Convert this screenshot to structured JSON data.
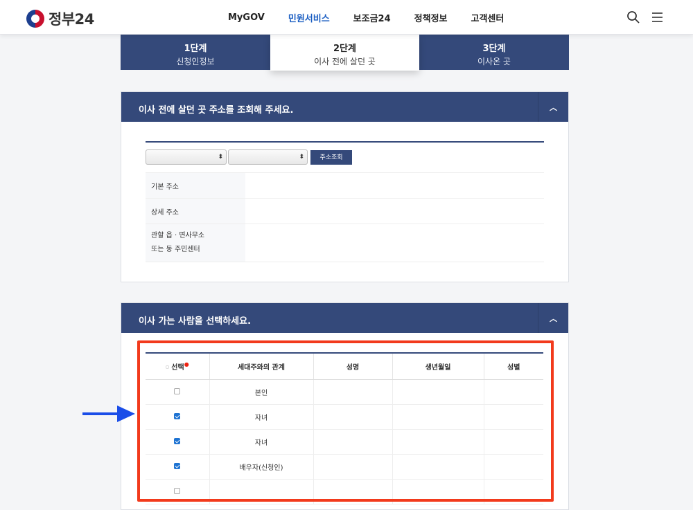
{
  "header": {
    "logo_text": "정부24",
    "nav": [
      "MyGOV",
      "민원서비스",
      "보조금24",
      "정책정보",
      "고객센터"
    ],
    "active_nav": "민원서비스"
  },
  "steps": [
    {
      "num": "1단계",
      "label": "신청인정보"
    },
    {
      "num": "2단계",
      "label": "이사 전에 살던 곳"
    },
    {
      "num": "3단계",
      "label": "이사온 곳"
    }
  ],
  "address_panel": {
    "title": "이사 전에 살던 곳 주소를 조회해 주세요.",
    "lookup_button": "주소조회",
    "rows": [
      {
        "label": "기본 주소"
      },
      {
        "label": "상세 주소"
      },
      {
        "label_line1": "관할 읍 · 면사무소",
        "label_line2": "또는 동 주민센터"
      }
    ]
  },
  "people_panel": {
    "title": "이사 가는 사람을 선택하세요.",
    "columns": [
      "선택",
      "세대주와의 관계",
      "성명",
      "생년월일",
      "성별"
    ],
    "rows": [
      {
        "checked": false,
        "relation": "본인"
      },
      {
        "checked": true,
        "relation": "자녀"
      },
      {
        "checked": true,
        "relation": "자녀"
      },
      {
        "checked": true,
        "relation": "배우자(신청인)"
      },
      {
        "checked": false,
        "relation": ""
      }
    ]
  },
  "colors": {
    "navy": "#34497a",
    "highlight_frame": "#f23a1c",
    "arrow": "#1a4de8",
    "active_nav": "#1b5ec2"
  }
}
